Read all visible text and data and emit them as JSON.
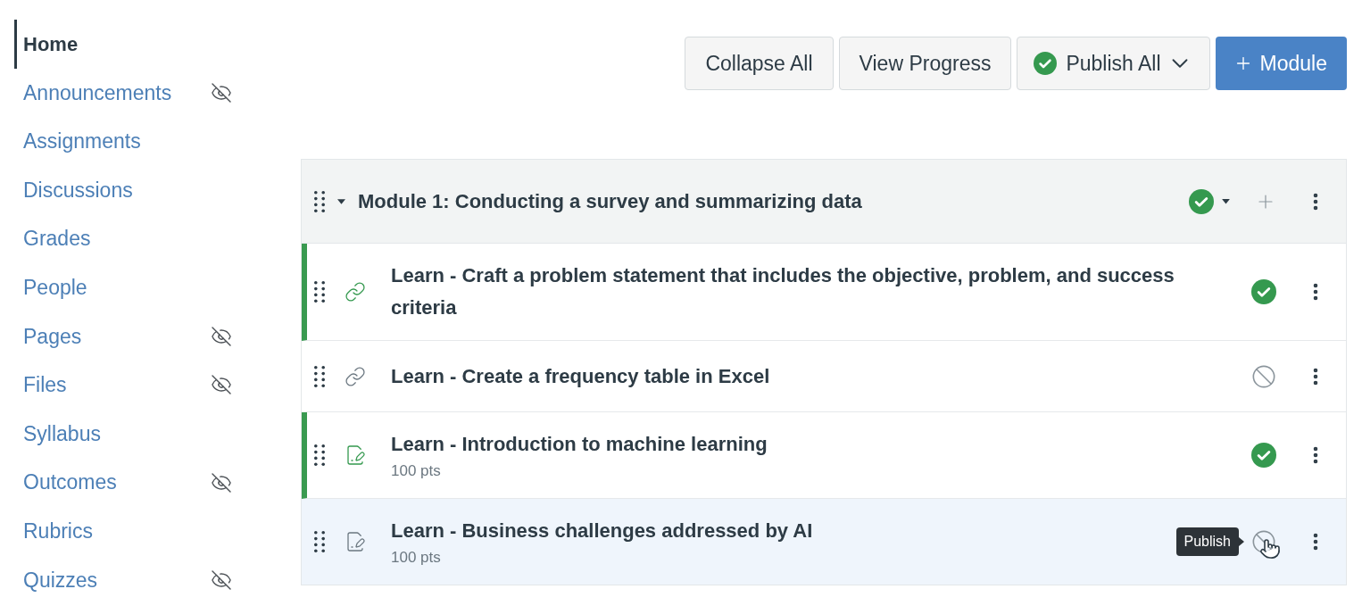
{
  "sidebar": {
    "items": [
      {
        "label": "Home",
        "selected": true,
        "hidden": false
      },
      {
        "label": "Announcements",
        "selected": false,
        "hidden": true
      },
      {
        "label": "Assignments",
        "selected": false,
        "hidden": false
      },
      {
        "label": "Discussions",
        "selected": false,
        "hidden": false
      },
      {
        "label": "Grades",
        "selected": false,
        "hidden": false
      },
      {
        "label": "People",
        "selected": false,
        "hidden": false
      },
      {
        "label": "Pages",
        "selected": false,
        "hidden": true
      },
      {
        "label": "Files",
        "selected": false,
        "hidden": true
      },
      {
        "label": "Syllabus",
        "selected": false,
        "hidden": false
      },
      {
        "label": "Outcomes",
        "selected": false,
        "hidden": true
      },
      {
        "label": "Rubrics",
        "selected": false,
        "hidden": false
      },
      {
        "label": "Quizzes",
        "selected": false,
        "hidden": true
      }
    ]
  },
  "toolbar": {
    "buttons": [
      {
        "kind": "default",
        "label": "Collapse All"
      },
      {
        "kind": "default",
        "label": "View Progress"
      },
      {
        "kind": "publish",
        "label": "Publish All",
        "published": true
      },
      {
        "kind": "add",
        "label": "Module"
      }
    ]
  },
  "module": {
    "title": "Module 1: Conducting a survey and summarizing data",
    "expanded": true,
    "published": true,
    "items": [
      {
        "kind": "link",
        "title": "Learn - Craft a problem statement that includes the objective, problem, and success criteria",
        "published": true,
        "hovered": false
      },
      {
        "kind": "link",
        "title": "Learn - Create a frequency table in Excel",
        "published": false,
        "hovered": false
      },
      {
        "kind": "assignment",
        "title": "Learn - Introduction to machine learning",
        "points": "100 pts",
        "published": true,
        "hovered": false
      },
      {
        "kind": "assignment",
        "title": "Learn - Business challenges addressed by AI",
        "points": "100 pts",
        "published": false,
        "hovered": true,
        "tooltip": "Publish"
      }
    ]
  }
}
